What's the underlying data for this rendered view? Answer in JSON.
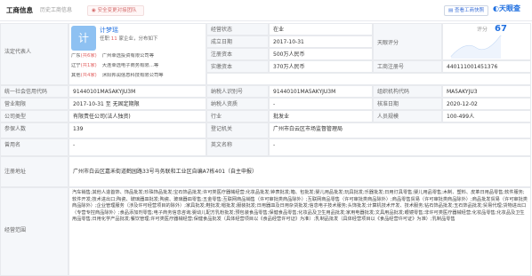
{
  "header": {
    "title": "工商信息",
    "subtab": "历史工商信息",
    "notice": "安全变更对接团队",
    "report_button": "查看工商快照",
    "brand": "天眼查"
  },
  "legal": {
    "label": "法定代表人",
    "avatar_char": "计",
    "name": "计梦瑶",
    "stats_prefix": "任职",
    "stats_count": "11",
    "stats_suffix": "家企业，分布如下",
    "relations": [
      {
        "region": "广东",
        "count": "(共6家)",
        "company": "广州幸选投资有限公司等"
      },
      {
        "region": "辽宁",
        "count": "(共1家)",
        "company": "大连幸选电子商务有限…等"
      },
      {
        "region": "其他",
        "count": "(共4家)",
        "company": "沭阳邦润信息科技有限公司等"
      }
    ]
  },
  "status": {
    "label": "经营状态",
    "value": "在业"
  },
  "established": {
    "label": "成立日期",
    "value": "2017-10-31"
  },
  "registered_capital": {
    "label": "注册资本",
    "value": "500万人民币"
  },
  "paid_capital": {
    "label": "实缴资本",
    "value": "370万人民币"
  },
  "reg_no": {
    "label": "工商注册号",
    "value": "440111001451376"
  },
  "score": {
    "label": "天眼评分",
    "sublabel": "评分",
    "value": "67"
  },
  "credit_code": {
    "label": "统一社会信用代码",
    "value": "91440101MA5AKYJU3M"
  },
  "taxpayer_id": {
    "label": "纳税人识别号",
    "value": "91440101MA5AKYJU3M"
  },
  "org_code": {
    "label": "组织机构代码",
    "value": "MA5AKYJU3"
  },
  "term": {
    "label": "营业期限",
    "value": "2017-10-31 至 无固定期限"
  },
  "taxpayer_qual": {
    "label": "纳税人资质",
    "value": "-"
  },
  "approval_date": {
    "label": "核准日期",
    "value": "2020-12-02"
  },
  "company_type": {
    "label": "公司类型",
    "value": "有限责任公司(法人独资)"
  },
  "industry": {
    "label": "行业",
    "value": "批发业"
  },
  "staff_size": {
    "label": "人员规模",
    "value": "100-499人"
  },
  "insured": {
    "label": "参保人数",
    "value": "139"
  },
  "authority": {
    "label": "登记机关",
    "value": "广州市白云区市场监督管理局"
  },
  "former_name": {
    "label": "曾用名",
    "value": "-"
  },
  "english_name": {
    "label": "英文名称",
    "value": "-"
  },
  "address": {
    "label": "注册地址",
    "value": "广州市白云区嘉禾街道鹤园路33号马务联和工业区自编A7栋401（自主申报）"
  },
  "scope": {
    "label": "经营范围",
    "value": "汽车销售;其他人造首饰、饰品批发;珍珠饰品批发;宝石饰品批发;许可类医疗器械经营;化妆品批发;钟表批发;箱、包批发;婴儿用品批发;玩具批发;乐器批发;日用灯具零售;婴儿用品零售;木制、塑料、皮革日用品零售;软件服务;软件开发;技术进出口;陶瓷、玻璃器皿批发;陶瓷、玻璃器皿零售;五金零售;互联网商品销售（许可审批类商品除外）;互联网商品零售（许可审批类商品除外）;商品零售贸易（许可审批类商品除外）;商品批发贸易（许可审批类商品除外）;企业管理服务（涉及许可经营项目的除外）;家具批发;鞋批发;帽批发;服装批发;日用器皿及日用杂货批发;信息电子技术服务;头饰批发;计算机技术开发、技术服务;钻石饰品批发;玉石饰品批发;贸易代理;货物进出口（专营专控商品除外）;食品添加剂零售;电子商务信息咨询;婴幼儿配方乳粉批发;预包装食品零售;保健食品零售;化妆品及卫生用品批发;家用电器批发;文具用品批发;眼镜零售;非许可类医疗器械经营;化妆品零售;化妆品及卫生用品零售;日用化学产品批发;餐饮管理;许可类医疗器械经营;保健食品批发（具体经营项目以《食品经营许可证》为准）;乳制品批发（具体经营项目以《食品经营许可证》为准）;乳制品零售"
  },
  "colors": {
    "accent": "#1f6fe0",
    "highlight": "#e25f5f",
    "label_bg": "#f5f7fa",
    "border": "#e8eaee"
  }
}
